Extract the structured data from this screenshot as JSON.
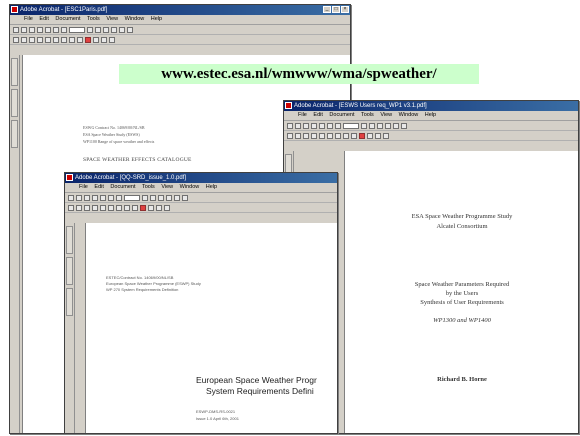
{
  "app_name": "Adobe Acrobat",
  "windows": [
    {
      "title": "Adobe Acrobat - [ESC1Paris.pdf]",
      "menu": [
        "File",
        "Edit",
        "Document",
        "Tools",
        "View",
        "Window",
        "Help"
      ],
      "page_lines": [
        "ESWG Contract No. 14069/00/NL/SB",
        "ESA Space Weather Study (ESWS)",
        "WP1100 Range of space weather and effects",
        "SPACE WEATHER EFFECTS CATALOGUE"
      ]
    },
    {
      "title": "Adobe Acrobat - [ESWS Users req_WP1 v3.1.pdf]",
      "menu": [
        "File",
        "Edit",
        "Document",
        "Tools",
        "View",
        "Window",
        "Help"
      ],
      "page_lines": [
        "ESA Space Weather Programme Study",
        "Alcatel Consortium",
        "Space Weather Parameters Required",
        "by the Users",
        "Synthesis of User Requirements",
        "WP1300 and WP1400",
        "Richard B. Horne"
      ]
    },
    {
      "title": "Adobe Acrobat - [QQ-SRD_issue_1.0.pdf]",
      "menu": [
        "File",
        "Edit",
        "Document",
        "Tools",
        "View",
        "Window",
        "Help"
      ],
      "page_lines": [
        "ESTEC/Contract No. 14069/00/NL/SB",
        "European Space Weather Programme (ESWP) Study",
        "WP 270 System Requirements Definition",
        "European Space Weather Progr",
        "System Requirements Defini",
        "ESWP-DMS-RS-0021",
        "Issue 1.0        April 6th, 2001"
      ]
    }
  ],
  "banner": {
    "url": "www.estec.esa.nl/wmwww/wma/spweather/"
  },
  "colors": {
    "banner_bg": "#ccffcc",
    "titlebar": "#0a246a"
  }
}
